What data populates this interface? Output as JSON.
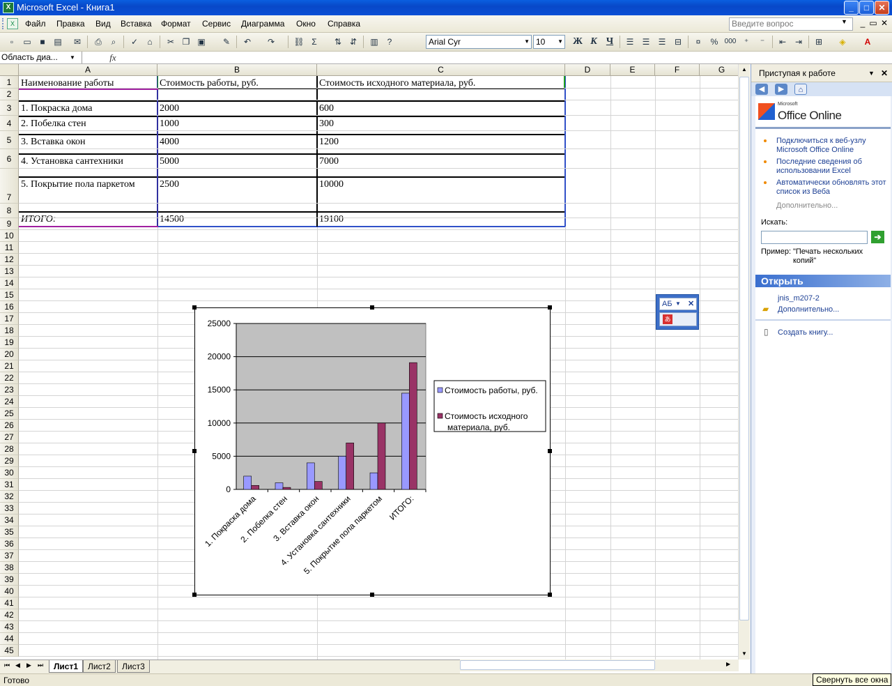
{
  "titlebar": {
    "title": "Microsoft Excel - Книга1",
    "min": "_",
    "max": "□",
    "close": "✕"
  },
  "menu": {
    "items": [
      "Файл",
      "Правка",
      "Вид",
      "Вставка",
      "Формат",
      "Сервис",
      "Диаграмма",
      "Окно",
      "Справка"
    ],
    "help_placeholder": "Введите вопрос"
  },
  "toolbar": {
    "font": "Arial Cyr",
    "size": "10",
    "bold": "Ж",
    "italic": "К",
    "underline": "Ч",
    "sigma": "Σ",
    "percent": "%",
    "thousands": "000"
  },
  "formula_bar": {
    "name_box": "Область диа...",
    "fx": "fx"
  },
  "sheet": {
    "columns": [
      "A",
      "B",
      "C",
      "D",
      "E",
      "F",
      "G"
    ],
    "rows": [
      "1",
      "2",
      "3",
      "4",
      "5",
      "6",
      "7",
      "8",
      "9",
      "10",
      "11",
      "12",
      "13",
      "14",
      "15",
      "16",
      "17",
      "18",
      "19",
      "20",
      "21",
      "22",
      "23",
      "24",
      "25",
      "26",
      "27",
      "28",
      "29",
      "30",
      "31",
      "32",
      "33",
      "34",
      "35",
      "36",
      "37",
      "38",
      "39",
      "40",
      "41",
      "42",
      "43",
      "44",
      "45"
    ],
    "table": {
      "header": [
        "Наименование работы",
        "Стоимость работы, руб.",
        "Стоимость исходного материала, руб."
      ],
      "rows": [
        [
          "1. Покраска дома",
          "2000",
          "600"
        ],
        [
          "2. Побелка стен",
          "1000",
          "300"
        ],
        [
          "3. Вставка окон",
          "4000",
          "1200"
        ],
        [
          "4. Установка сантехники",
          "5000",
          "7000"
        ],
        [
          "5. Покрытие пола паркетом",
          "2500",
          "10000"
        ]
      ],
      "total": [
        "ИТОГО:",
        "14500",
        "19100"
      ]
    }
  },
  "chart_data": {
    "type": "bar",
    "categories": [
      "1. Покраска дома",
      "2. Побелка стен",
      "3. Вставка окон",
      "4. Установка сантехники",
      "5. Покрытие пола паркетом",
      "ИТОГО:"
    ],
    "series": [
      {
        "name": "Стоимость работы, руб.",
        "values": [
          2000,
          1000,
          4000,
          5000,
          2500,
          14500
        ],
        "color": "#9999ff"
      },
      {
        "name": "Стоимость исходного материала, руб.",
        "values": [
          600,
          300,
          1200,
          7000,
          10000,
          19100
        ],
        "color": "#993366"
      }
    ],
    "yticks": [
      "0",
      "5000",
      "10000",
      "15000",
      "20000",
      "25000"
    ],
    "ylim": [
      0,
      25000
    ],
    "plot_bg": "#c0c0c0",
    "legend": "right",
    "grid": true
  },
  "sheet_tabs": [
    "Лист1",
    "Лист2",
    "Лист3"
  ],
  "status": {
    "left": "Готово",
    "tooltip": "Свернуть все окна"
  },
  "taskpane": {
    "title": "Приступая к работе",
    "brand_small": "Microsoft",
    "brand": "Office Online",
    "links": [
      "Подключиться к веб-узлу Microsoft Office Online",
      "Последние сведения об использовании Excel",
      "Автоматически обновлять этот список из Веба"
    ],
    "more": "Дополнительно...",
    "search_label": "Искать:",
    "example_label": "Пример:",
    "example_text": "\"Печать нескольких копий\"",
    "open_title": "Открыть",
    "recent_file": "jnis_m207-2",
    "open_more": "Дополнительно...",
    "create": "Создать книгу..."
  },
  "ab_widget": {
    "label": "АБ"
  }
}
